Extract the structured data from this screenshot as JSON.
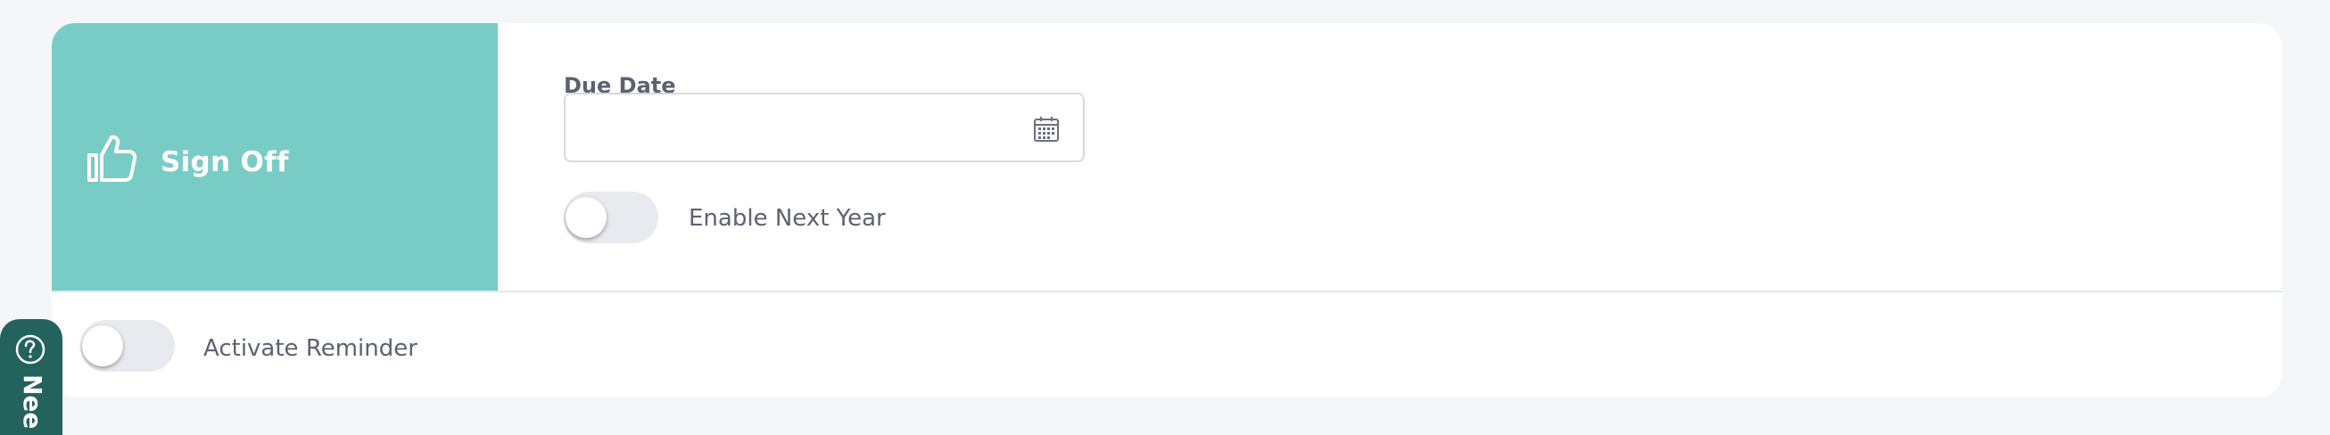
{
  "sign_off": {
    "title": "Sign Off",
    "icon": "thumbs-up-icon",
    "panel_color": "#79ccc5"
  },
  "due_date": {
    "label": "Due Date",
    "value": "",
    "icon": "calendar-icon"
  },
  "enable_next_year": {
    "label": "Enable Next Year",
    "checked": false
  },
  "activate_reminder": {
    "label": "Activate Reminder",
    "checked": false
  },
  "help_tab": {
    "label": "Nee",
    "icon": "help-question-icon",
    "color": "#23625d"
  }
}
